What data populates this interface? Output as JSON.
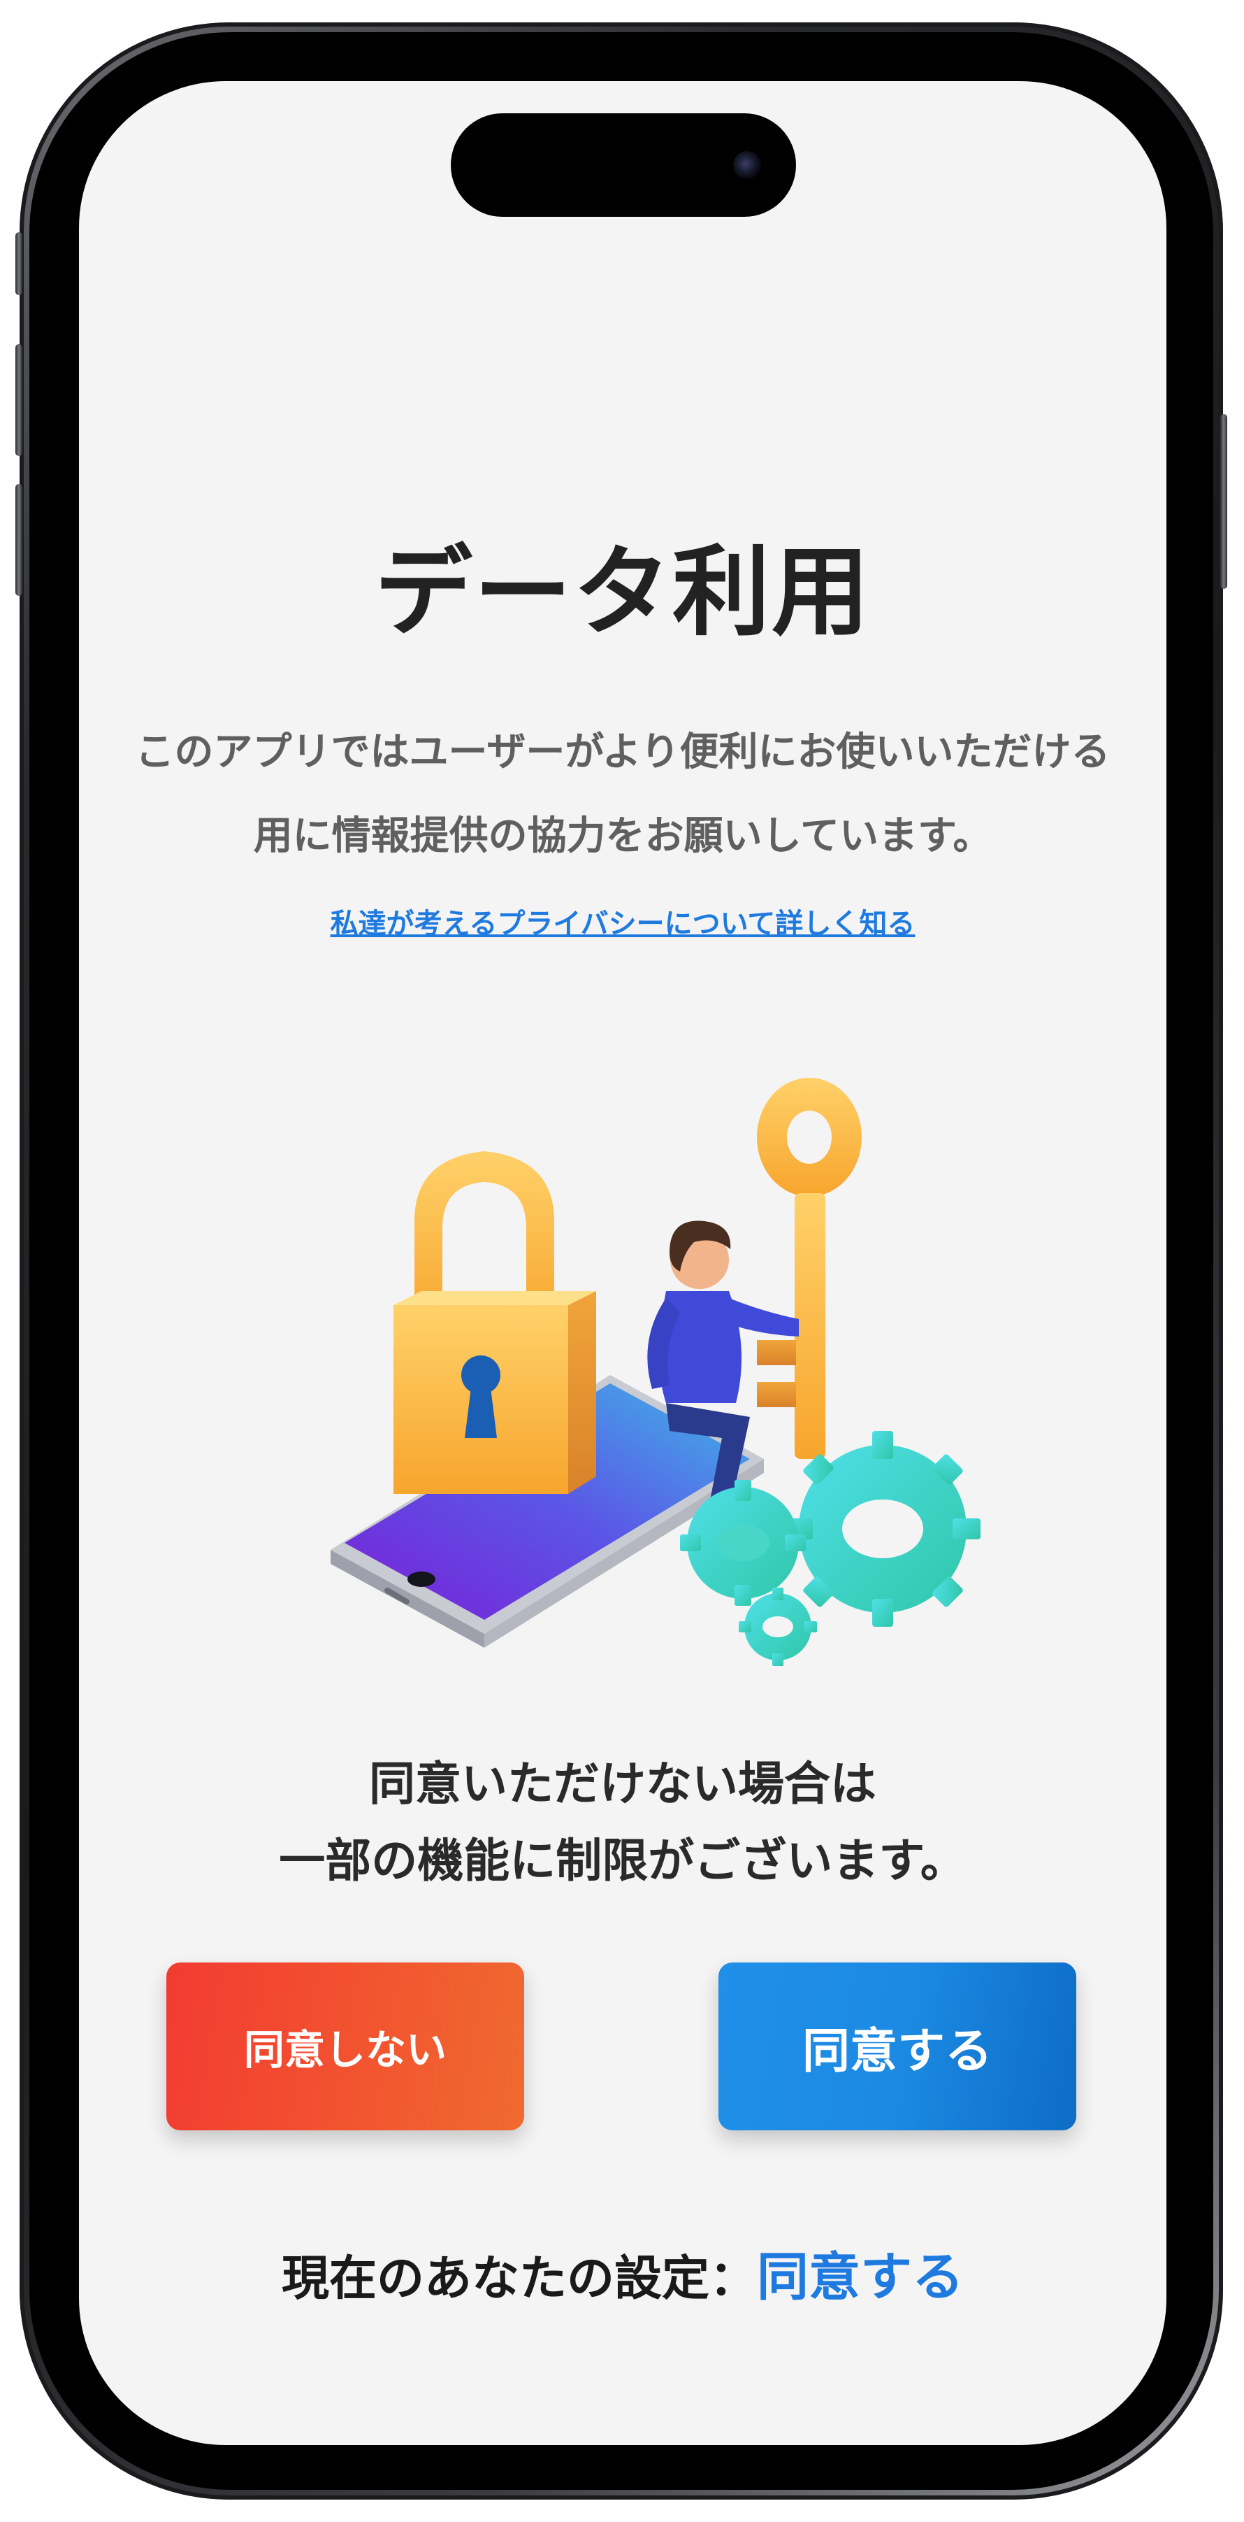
{
  "screen": {
    "title": "データ利用",
    "description_line1": "このアプリではユーザーがより便利にお使いいただける",
    "description_line2": "用に情報提供の協力をお願いしています。",
    "privacy_link": "私達が考えるプライバシーについて詳しく知る",
    "illustration_icon": "security-lock-key-illustration",
    "notice_line1": "同意いただけない場合は",
    "notice_line2": "一部の機能に制限がございます。",
    "buttons": {
      "decline_label": "同意しない",
      "agree_label": "同意する"
    },
    "current_setting": {
      "label": "現在のあなたの設定：",
      "value": "同意する"
    }
  },
  "colors": {
    "background": "#f4f4f4",
    "title_text": "#222222",
    "description_text": "#5f5f5f",
    "link": "#1f7ae0",
    "decline_button": "#f2452f",
    "agree_button": "#1a86e0",
    "setting_value": "#1f7ae0"
  }
}
